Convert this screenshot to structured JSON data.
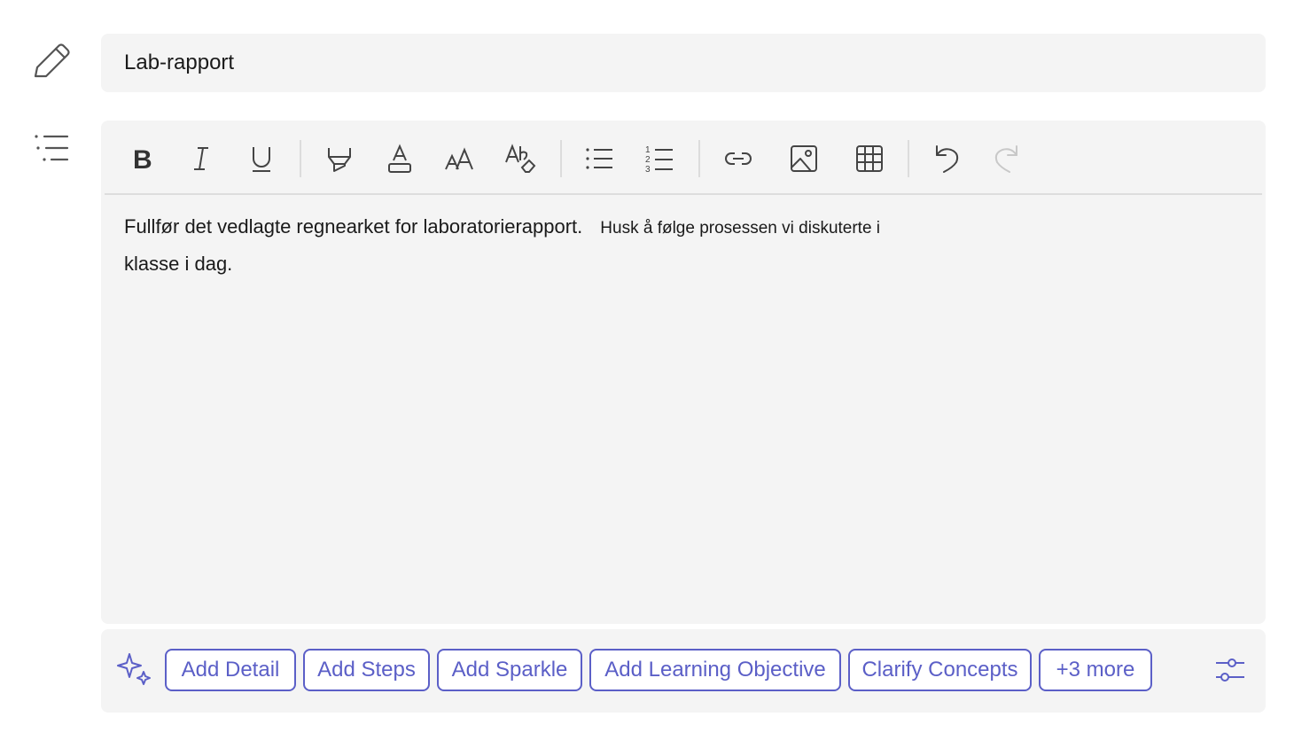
{
  "title_field": {
    "value": "Lab-rapport"
  },
  "side_icons": {
    "title_icon": "pencil-icon",
    "description_icon": "list-icon"
  },
  "toolbar": {
    "buttons": [
      "bold",
      "italic",
      "underline",
      "highlight",
      "font-color",
      "font-size",
      "clear-formatting",
      "bullet-list",
      "numbered-list",
      "link",
      "image",
      "table",
      "undo",
      "redo"
    ],
    "redo_enabled": false
  },
  "editor": {
    "line1": "Fullfør det vedlagte regnearket for laboratorierapport.",
    "line1_small": "Husk å følge prosessen vi diskuterte i",
    "line2": "klasse i dag."
  },
  "suggestions": {
    "chips": [
      {
        "label": "Add Detail"
      },
      {
        "label": "Add Steps"
      },
      {
        "label": "Add Sparkle"
      },
      {
        "label": "Add Learning Objective"
      },
      {
        "label": "Clarify Concepts"
      },
      {
        "label": "+3 more"
      }
    ],
    "accent": "#5b5fc7"
  }
}
